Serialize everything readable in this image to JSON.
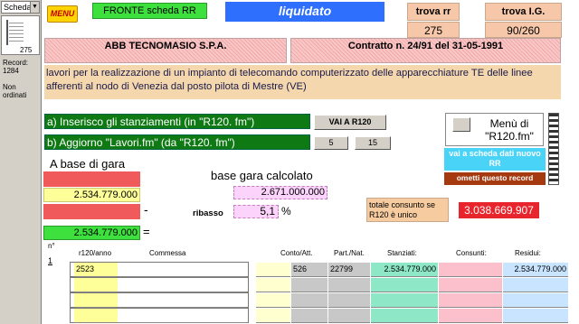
{
  "left_panel": {
    "view_select": "Scheda ...",
    "thumb_number": "275",
    "record_label": "Record:",
    "record_count": "1284",
    "sort_status": "Non ordinati"
  },
  "header": {
    "menu_label": "MENU",
    "fronte_label": "FRONTE scheda RR",
    "status": "liquidato",
    "trova_rr_label": "trova rr",
    "trova_rr_value": "275",
    "trova_ig_label": "trova I.G.",
    "trova_ig_value": "90/260"
  },
  "company": "ABB TECNOMASIO S.P.A.",
  "contract": "Contratto n. 24/91 del 31-05-1991",
  "description": "lavori per la realizzazione di un impianto di telecomando computerizzato delle apparecchiature TE delle linee afferenti al nodo di Venezia dal posto pilota di Mestre (VE)",
  "actions": {
    "a_label": "a) Inserisco gli stanziamenti (in \"R120. fm\")",
    "b_label": "b) Aggiorno \"Lavori.fm\"  (da \"R120. fm\")",
    "vai_label": "VAI A R120",
    "btn5_label": "5",
    "btn15_label": "15",
    "menu_di_label": "Menù di \"R120.fm\"",
    "vai_scheda_label": "vai a scheda dati nuovo RR",
    "ometti_label": "ometti questo record"
  },
  "base_gara": {
    "title": "A base di gara",
    "value": "2.534.779.000",
    "minus": "-",
    "total": "2.534.779.000",
    "equals": "=",
    "calc_title": "base gara calcolato",
    "calc_value": "2.671.000.000",
    "ribasso_label": "ribasso",
    "ribasso_value": "5,1",
    "percent": "%",
    "consumo_label": "totale consunto se R120 è unico",
    "consumo_value": "3.038.669.907"
  },
  "table": {
    "headers": {
      "n": "n°",
      "r120": "r120/anno",
      "commessa": "Commessa",
      "conto": "Conto/Att.",
      "part": "Part./Nat.",
      "stanziati": "Stanziati:",
      "consunti": "Consunti:",
      "residui": "Residui:"
    },
    "index": "1",
    "rows": [
      {
        "r120": "2523",
        "commessa": "",
        "conto": "526",
        "part": "22799",
        "stanziati": "2.534.779.000",
        "consunti": "",
        "residui": "2.534.779.000"
      },
      {
        "r120": "",
        "commessa": "",
        "conto": "",
        "part": "",
        "stanziati": "",
        "consunti": "",
        "residui": ""
      },
      {
        "r120": "",
        "commessa": "",
        "conto": "",
        "part": "",
        "stanziati": "",
        "consunti": "",
        "residui": ""
      },
      {
        "r120": "",
        "commessa": "",
        "conto": "",
        "part": "",
        "stanziati": "",
        "consunti": "",
        "residui": ""
      }
    ]
  }
}
